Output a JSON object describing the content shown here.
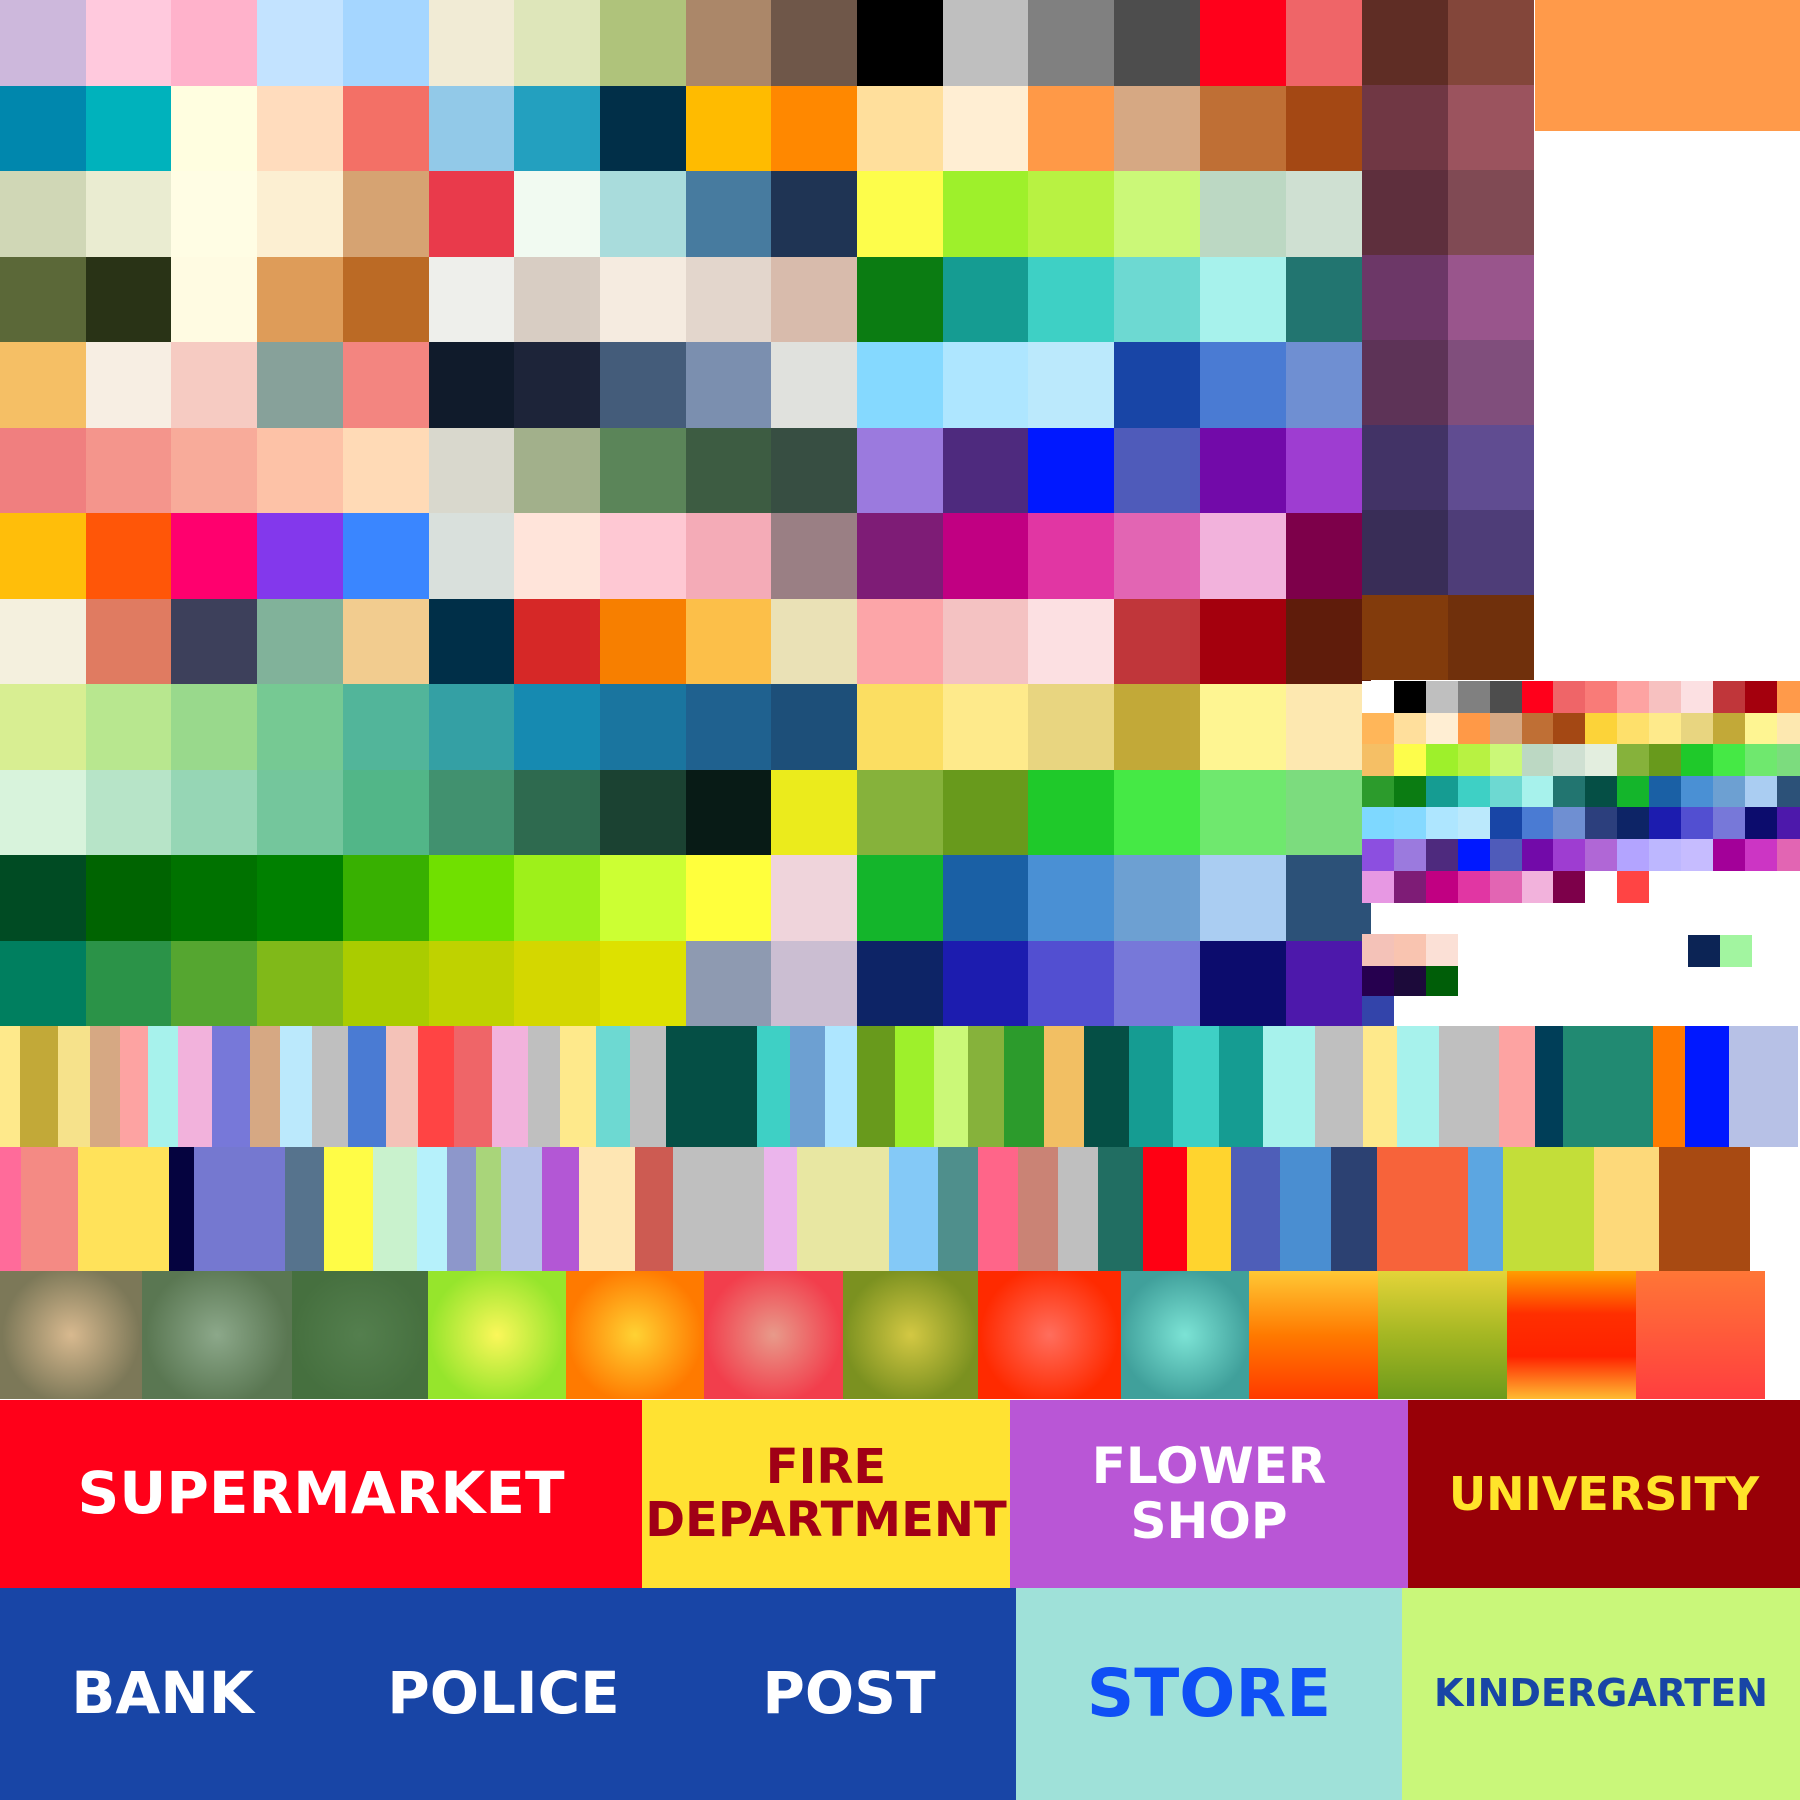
{
  "palette": {
    "big_grid": [
      [
        "#cdb8dc",
        "#ffc9dd",
        "#ffb2cb",
        "#c3e3ff",
        "#a5d6ff",
        "#f1ebd5",
        "#dee6ba",
        "#afc37b",
        "#ab8769",
        "#6f5749",
        "#000000",
        "#bfbfbf",
        "#808080",
        "#4d4d4d",
        "#ff001b",
        "#ef6568"
      ],
      [
        "#0087ad",
        "#00b2bc",
        "#fffee0",
        "#ffdcbd",
        "#f37066",
        "#92c9e8",
        "#23a0bf",
        "#012f48",
        "#ffbb00",
        "#ff8800",
        "#ffdf9c",
        "#ffeed3",
        "#ff9947",
        "#d6a883",
        "#bf6f35",
        "#a44814"
      ],
      [
        "#d0d7b6",
        "#eaecd1",
        "#fffde4",
        "#fcefd2",
        "#d6a372",
        "#e93a4b",
        "#f1faf1",
        "#a9dcdc",
        "#477b9f",
        "#1f3454",
        "#fdfd4b",
        "#9ef02b",
        "#b8f242",
        "#cbf878",
        "#bcd8c3",
        "#cfe0d2"
      ],
      [
        "#5b6838",
        "#293316",
        "#fffbe2",
        "#de9c59",
        "#bb6a25",
        "#eeefeb",
        "#d8cdc3",
        "#f5ebe0",
        "#e3d6cc",
        "#d8bbac",
        "#0b7c12",
        "#159c92",
        "#3ed0c5",
        "#6dd9d2",
        "#a7f2ec",
        "#227570"
      ],
      [
        "#f5bf65",
        "#f7eee3",
        "#f6cbc2",
        "#87a19a",
        "#f38580",
        "#101b2b",
        "#1d2439",
        "#445c7a",
        "#7b8faf",
        "#e0e1dd",
        "#85d9ff",
        "#aee6ff",
        "#bbe9fc",
        "#1845a6",
        "#4a7bd3",
        "#6f8fd2"
      ],
      [
        "#f07f7f",
        "#f4958c",
        "#f8ab9a",
        "#fdc2a7",
        "#ffdab6",
        "#d9d8cd",
        "#a2b08b",
        "#5b8559",
        "#3d5c42",
        "#374e42",
        "#9b7ade",
        "#4e2a7e",
        "#0018ff",
        "#4f5bba",
        "#720aa9",
        "#9e3dd1"
      ],
      [
        "#ffbe0a",
        "#ff5608",
        "#ff006e",
        "#8338ec",
        "#3a86ff",
        "#d9e0dc",
        "#ffe4da",
        "#fec8d3",
        "#f4abb7",
        "#9a7f84",
        "#7e1c76",
        "#c10082",
        "#e136a3",
        "#e265b3",
        "#f2b2dc",
        "#7d004a"
      ],
      [
        "#f4f0de",
        "#e07b61",
        "#3d405b",
        "#81b29a",
        "#f2cc8f",
        "#002f48",
        "#d62827",
        "#f77f00",
        "#fcbf49",
        "#eae1b6",
        "#fca5a8",
        "#f4c2c2",
        "#fce0e2",
        "#c0363a",
        "#a4000d",
        "#5f1c0b"
      ],
      [
        "#d8ee92",
        "#b8e78f",
        "#99d98c",
        "#76c993",
        "#52b59a",
        "#34a0a4",
        "#168ab1",
        "#1a759f",
        "#1f618f",
        "#1d4f79",
        "#fbde62",
        "#feea8b",
        "#e8d580",
        "#c2a938",
        "#fef592",
        "#fde8b0"
      ],
      [
        "#d8f3dc",
        "#b7e4c8",
        "#96d6b5",
        "#74c69c",
        "#52b688",
        "#41916f",
        "#2e6a4f",
        "#1b4232",
        "#081b16",
        "#ebeb1c",
        "#86b23b",
        "#689a1c",
        "#1fc92a",
        "#45e945",
        "#6fe86e",
        "#7cdc7e"
      ],
      [
        "#004b23",
        "#006401",
        "#007200",
        "#008000",
        "#38b001",
        "#70e000",
        "#9ef01a",
        "#ccff33",
        "#ffff3c",
        "#efd4db",
        "#14b52b",
        "#1a60a5",
        "#4a90d4",
        "#6da0d2",
        "#aacdf2",
        "#2c5178"
      ],
      [
        "#007f5f",
        "#2b9348",
        "#55a630",
        "#80b919",
        "#aacc00",
        "#bfd200",
        "#d4d700",
        "#dde100",
        "#8e9ab1",
        "#cbbed2",
        "#0d2466",
        "#1c1caf",
        "#524fd1",
        "#7778d9",
        "#0c0c6d",
        "#4d18ab"
      ]
    ],
    "right_col": [
      [
        "#5f2d25",
        "#83463a"
      ],
      [
        "#703744",
        "#9b535e"
      ],
      [
        "#5e2f3d",
        "#804a54"
      ],
      [
        "#6c3767",
        "#99558c"
      ],
      [
        "#5d3357",
        "#804e7c"
      ],
      [
        "#423366",
        "#604c91"
      ],
      [
        "#392d57",
        "#4e3d78"
      ],
      [
        "#823b0c",
        "#70300c"
      ]
    ],
    "orange_block": "#ff9a4a",
    "small_grid": [
      [
        "#ffffff",
        "#000000",
        "#bfbfbf",
        "#808080",
        "#4d4d4d",
        "#ff001b",
        "#ef6568",
        "#f97b78",
        "#fda3a2",
        "#f7c1c0",
        "#fce0e2",
        "#c0363a",
        "#a4000d",
        "#ff9a4a"
      ],
      [
        "#ffb659",
        "#ffdf9c",
        "#ffeed3",
        "#ff9947",
        "#d6a883",
        "#bf6f35",
        "#a44814",
        "#fcd339",
        "#fee06b",
        "#feea8b",
        "#e8d580",
        "#c2a938",
        "#fef592",
        "#fde8b0"
      ],
      [
        "#f5bf65",
        "#fdfd4b",
        "#9ef02b",
        "#b8f242",
        "#cbf878",
        "#bcd8c3",
        "#cfe0d2",
        "#e3eedf",
        "#86b23b",
        "#689a1c",
        "#1fc92a",
        "#45e945",
        "#6fe86e",
        "#7cdc7e"
      ],
      [
        "#2c9b2c",
        "#0b7c12",
        "#159c92",
        "#3ed0c5",
        "#6dd9d2",
        "#a7f2ec",
        "#227570",
        "#054f45",
        "#14b52b",
        "#1a60a5",
        "#4a90d4",
        "#6da0d2",
        "#aacdf2",
        "#2c5178"
      ],
      [
        "#7ed8ff",
        "#85d9ff",
        "#aee6ff",
        "#bbe9fc",
        "#1845a6",
        "#4a7bd3",
        "#6f8fd2",
        "#2c3f7d",
        "#0d2466",
        "#1c1caf",
        "#524fd1",
        "#7778d9",
        "#0c0c6d",
        "#4d18ab"
      ],
      [
        "#8c4fe0",
        "#9b7ade",
        "#4e2a7e",
        "#0018ff",
        "#4f5bba",
        "#720aa9",
        "#9e3dd1",
        "#b067d6",
        "#b3a4ff",
        "#bdb7ff",
        "#c6bcff",
        "#a30099",
        "#cc35c4",
        "#e265b3"
      ],
      [
        "#e798e3",
        "#7e1c76",
        "#c10082",
        "#e136a3",
        "#e265b3",
        "#f2b2dc",
        "#7d004a",
        "#ffffff",
        "#ff4444",
        "#ffffff",
        "#ffffff",
        "#ffffff",
        "#ffffff",
        "#ffffff"
      ]
    ],
    "small_extras": {
      "row_a": [
        "#f4c2b8",
        "#f9c4b0",
        "#fbe0d6"
      ],
      "row_b": [
        "#26004f",
        "#1c0a3a",
        "#005e08"
      ],
      "row_c": [
        "#3344aa"
      ],
      "pair": [
        "#0c2455",
        "#a2f5a0"
      ]
    },
    "stripe_row_1": [
      {
        "c": "#fee98b",
        "w": 20
      },
      {
        "c": "#c2a938",
        "w": 38
      },
      {
        "c": "#f6e28b",
        "w": 32
      },
      {
        "c": "#d6a883",
        "w": 30
      },
      {
        "c": "#fda3a2",
        "w": 28
      },
      {
        "c": "#a7f2ec",
        "w": 30
      },
      {
        "c": "#f2b2dc",
        "w": 34
      },
      {
        "c": "#7778d9",
        "w": 38
      },
      {
        "c": "#d6a883",
        "w": 30
      },
      {
        "c": "#bbe9fc",
        "w": 32
      },
      {
        "c": "#bfbfbf",
        "w": 36
      },
      {
        "c": "#4a7bd3",
        "w": 38
      },
      {
        "c": "#f4c2b8",
        "w": 32
      },
      {
        "c": "#ff4444",
        "w": 36
      },
      {
        "c": "#ef6568",
        "w": 38
      },
      {
        "c": "#f2b2dc",
        "w": 36
      },
      {
        "c": "#bfbfbf",
        "w": 32
      },
      {
        "c": "#fee98b",
        "w": 36
      },
      {
        "c": "#6dd9d2",
        "w": 34
      },
      {
        "c": "#bfbfbf",
        "w": 36
      },
      {
        "c": "#054f45",
        "w": 91
      },
      {
        "c": "#3ed0c5",
        "w": 33
      },
      {
        "c": "#6da0d2",
        "w": 35
      },
      {
        "c": "#aee6ff",
        "w": 32
      },
      {
        "c": "#689a1c",
        "w": 38
      },
      {
        "c": "#9ef02b",
        "w": 39
      },
      {
        "c": "#cbf878",
        "w": 34
      },
      {
        "c": "#86b23b",
        "w": 36
      },
      {
        "c": "#2c9b2c",
        "w": 40
      },
      {
        "c": "#f2bf63",
        "w": 40
      },
      {
        "c": "#054f45",
        "w": 45
      },
      {
        "c": "#159c92",
        "w": 44
      },
      {
        "c": "#3ed0c5",
        "w": 46
      },
      {
        "c": "#159c92",
        "w": 44
      },
      {
        "c": "#a7f2ec",
        "w": 52
      },
      {
        "c": "#bfbfbf",
        "w": 48
      },
      {
        "c": "#fee98b",
        "w": 34
      },
      {
        "c": "#a7f2ec",
        "w": 42
      },
      {
        "c": "#bfbfbf",
        "w": 60
      },
      {
        "c": "#fda3a2",
        "w": 36
      },
      {
        "c": "#003e58",
        "w": 28
      },
      {
        "c": "#218a72",
        "w": 90
      },
      {
        "c": "#ff7a00",
        "w": 32
      },
      {
        "c": "#0018ff",
        "w": 44
      },
      {
        "c": "#b7c1e6",
        "w": 69
      }
    ],
    "stripe_row_2": [
      {
        "c": "#ff6b9a",
        "w": 21
      },
      {
        "c": "#f48a84",
        "w": 57
      },
      {
        "c": "#ffe25a",
        "w": 91
      },
      {
        "c": "#05033f",
        "w": 25
      },
      {
        "c": "#7578d0",
        "w": 91
      },
      {
        "c": "#56738d",
        "w": 39
      },
      {
        "c": "#fffc46",
        "w": 49
      },
      {
        "c": "#c9f2cd",
        "w": 44
      },
      {
        "c": "#b6f1fb",
        "w": 30
      },
      {
        "c": "#8d97cb",
        "w": 29
      },
      {
        "c": "#a9d57a",
        "w": 25
      },
      {
        "c": "#b6c1e9",
        "w": 41
      },
      {
        "c": "#b357d5",
        "w": 37
      },
      {
        "c": "#fee6b3",
        "w": 56
      },
      {
        "c": "#cd5b52",
        "w": 38
      },
      {
        "c": "#bfbfbf",
        "w": 91
      },
      {
        "c": "#ebb5ec",
        "w": 33
      },
      {
        "c": "#e8e7a2",
        "w": 92
      },
      {
        "c": "#84c9f7",
        "w": 49
      },
      {
        "c": "#4f8f8c",
        "w": 40
      },
      {
        "c": "#ff6589",
        "w": 40
      },
      {
        "c": "#ca8375",
        "w": 40
      },
      {
        "c": "#bfbfbf",
        "w": 40
      },
      {
        "c": "#216e62",
        "w": 45
      },
      {
        "c": "#ff0013",
        "w": 44
      },
      {
        "c": "#ffd42e",
        "w": 44
      },
      {
        "c": "#4e5eb8",
        "w": 49
      },
      {
        "c": "#4a8ed1",
        "w": 51
      },
      {
        "c": "#2c4172",
        "w": 46
      },
      {
        "c": "#f7633a",
        "w": 91
      },
      {
        "c": "#5ca6e1",
        "w": 35
      },
      {
        "c": "#c3de39",
        "w": 91
      },
      {
        "c": "#fdd97a",
        "w": 65
      },
      {
        "c": "#a84a12",
        "w": 91
      }
    ],
    "gradients": [
      {
        "type": "radial",
        "c1": "#d8b98f",
        "c2": "#7c7858",
        "w": 142
      },
      {
        "type": "radial",
        "c1": "#8ca88a",
        "c2": "#5a7752",
        "w": 150
      },
      {
        "type": "radial",
        "c1": "#547f4e",
        "c2": "#46703f",
        "w": 136
      },
      {
        "type": "radial",
        "c1": "#fbf75a",
        "c2": "#96e52c",
        "w": 138
      },
      {
        "type": "radial",
        "c1": "#ffd233",
        "c2": "#ff7a00",
        "w": 138
      },
      {
        "type": "radial",
        "c1": "#e89a8a",
        "c2": "#f23e4c",
        "w": 139
      },
      {
        "type": "radial",
        "c1": "#d3c843",
        "c2": "#7b9120",
        "w": 135
      },
      {
        "type": "radial",
        "c1": "#ff6e5d",
        "c2": "#ff2a00",
        "w": 143
      },
      {
        "type": "radial",
        "c1": "#7ce3d5",
        "c2": "#40a09b",
        "w": 128
      },
      {
        "type": "linear",
        "stops": "#ffc835,#ff7a00,#ff3a00",
        "w": 129
      },
      {
        "type": "linear",
        "stops": "#e4d439,#a5b723,#6d9a1b",
        "w": 129
      },
      {
        "type": "linear",
        "stops": "#ff9e00,#ff2f00,#ff2200,#ffbb32",
        "w": 129
      },
      {
        "type": "linear",
        "stops": "#ff7636,#ff3e3f",
        "w": 129
      }
    ]
  },
  "signs": [
    {
      "id": "supermarket",
      "lines": [
        "SUPERMARKET"
      ],
      "bg": "#ff0019",
      "fg": "#ffffff"
    },
    {
      "id": "fire-department",
      "lines": [
        "FIRE",
        "DEPARTMENT"
      ],
      "bg": "#ffe232",
      "fg": "#a00016"
    },
    {
      "id": "flower-shop",
      "lines": [
        "FLOWER",
        "SHOP"
      ],
      "bg": "#b956d6",
      "fg": "#ffffff"
    },
    {
      "id": "university",
      "lines": [
        "UNIVERSITY"
      ],
      "bg": "#980007",
      "fg": "#ffe42a"
    },
    {
      "id": "bank",
      "lines": [
        "BANK"
      ],
      "bg": "#1845a6",
      "fg": "#ffffff"
    },
    {
      "id": "police",
      "lines": [
        "POLICE"
      ],
      "bg": "#1845a6",
      "fg": "#ffffff"
    },
    {
      "id": "post",
      "lines": [
        "POST"
      ],
      "bg": "#1845a6",
      "fg": "#ffffff"
    },
    {
      "id": "store",
      "lines": [
        "STORE"
      ],
      "bg": "#9fe1d9",
      "fg": "#0f4ff5"
    },
    {
      "id": "kindergarten",
      "lines": [
        "KINDERGARTEN"
      ],
      "bg": "#c9f77a",
      "fg": "#1845a6"
    }
  ]
}
